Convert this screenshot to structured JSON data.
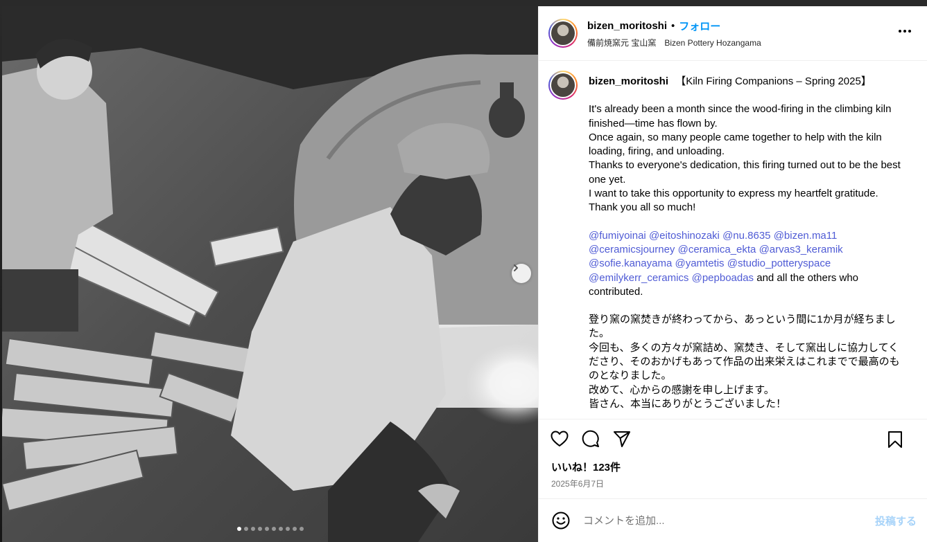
{
  "header": {
    "username": "bizen_moritoshi",
    "separator": "•",
    "follow_label": "フォロー",
    "subtitle": "備前焼窯元 宝山窯　Bizen Pottery Hozangama"
  },
  "caption": {
    "username": "bizen_moritoshi",
    "title": "【Kiln Firing Companions – Spring 2025】",
    "english_lines": [
      "It's already been a month since the wood-firing in the climbing kiln finished—time has flown by.",
      "Once again, so many people came together to help with the kiln loading, firing, and unloading.",
      "Thanks to everyone's dedication, this firing turned out to be the best one yet.",
      "I want to take this opportunity to express my heartfelt gratitude.",
      "Thank you all so much!"
    ],
    "mentions": [
      "@fumiyoinai",
      "@eitoshinozaki",
      "@nu.8635",
      "@bizen.ma11",
      "@ceramicsjourney",
      "@ceramica_ekta",
      "@arvas3_keramik",
      "@sofie.kanayama",
      "@yamtetis",
      "@studio_potteryspace",
      "@emilykerr_ceramics",
      "@pepboadas"
    ],
    "mentions_tail": "and all the others who contributed.",
    "japanese_lines": [
      "登り窯の窯焚きが終わってから、あっという間に1か月が経ちました。",
      "今回も、多くの方々が窯詰め、窯焚き、そして窯出しに協力してくださり、そのおかげもあって作品の出来栄えはこれまでで最高のものとなりました。",
      "改めて、心からの感謝を申し上げます。",
      "皆さん、本当にありがとうございました！"
    ]
  },
  "icons": {
    "like": "heart-icon",
    "comment": "comment-icon",
    "share": "send-icon",
    "save": "bookmark-icon",
    "more": "more-icon",
    "emoji": "emoji-icon",
    "next": "chevron-right-icon"
  },
  "stats": {
    "likes": "いいね！123件",
    "date": "2025年6月7日"
  },
  "comment": {
    "placeholder": "コメントを追加...",
    "post_label": "投稿する"
  },
  "carousel": {
    "slide_count": 10,
    "current_slide": 1
  },
  "colors": {
    "follow": "#0095f6",
    "mention": "#4f5bd5",
    "post_disabled": "#a7d3f9"
  }
}
